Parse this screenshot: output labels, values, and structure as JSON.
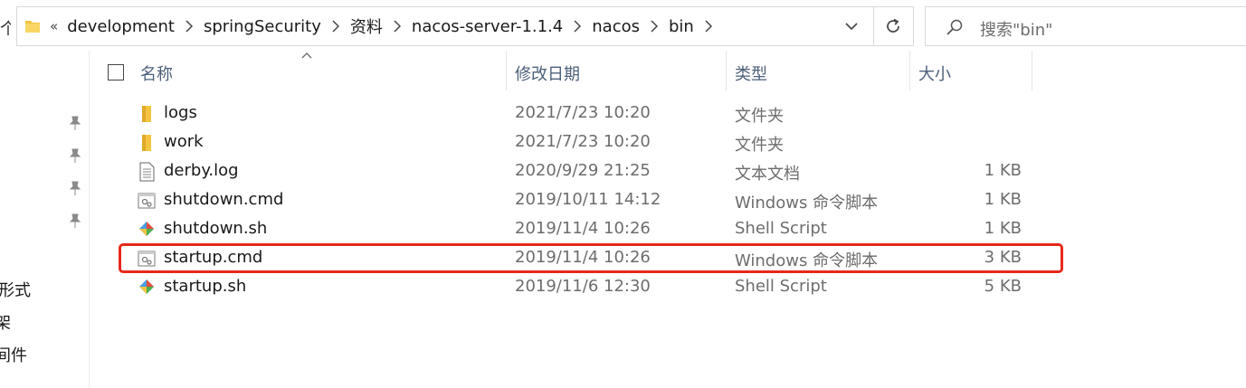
{
  "nav": {
    "up_glyph": "个",
    "quick_access_labels": [
      "形式",
      "架",
      "间件"
    ]
  },
  "address": {
    "overflow_glyph": "«",
    "breadcrumbs": [
      "development",
      "springSecurity",
      "资料",
      "nacos-server-1.1.4",
      "nacos",
      "bin"
    ]
  },
  "search": {
    "placeholder": "搜索\"bin\""
  },
  "columns": {
    "name": "名称",
    "date": "修改日期",
    "type": "类型",
    "size": "大小"
  },
  "files": [
    {
      "name": "logs",
      "date": "2021/7/23 10:20",
      "type": "文件夹",
      "size": "",
      "icon": "folder-icon"
    },
    {
      "name": "work",
      "date": "2021/7/23 10:20",
      "type": "文件夹",
      "size": "",
      "icon": "folder-icon"
    },
    {
      "name": "derby.log",
      "date": "2020/9/29 21:25",
      "type": "文本文档",
      "size": "1 KB",
      "icon": "text-file-icon"
    },
    {
      "name": "shutdown.cmd",
      "date": "2019/10/11 14:12",
      "type": "Windows 命令脚本",
      "size": "1 KB",
      "icon": "cmd-file-icon"
    },
    {
      "name": "shutdown.sh",
      "date": "2019/11/4 10:26",
      "type": "Shell Script",
      "size": "1 KB",
      "icon": "shell-script-icon"
    },
    {
      "name": "startup.cmd",
      "date": "2019/11/4 10:26",
      "type": "Windows 命令脚本",
      "size": "3 KB",
      "icon": "cmd-file-icon"
    },
    {
      "name": "startup.sh",
      "date": "2019/11/6 12:30",
      "type": "Shell Script",
      "size": "5 KB",
      "icon": "shell-script-icon"
    }
  ],
  "highlighted_file": "startup.cmd",
  "colors": {
    "highlight": "#e8281c",
    "folder": "#f4c542",
    "header_text": "#4c607a"
  }
}
